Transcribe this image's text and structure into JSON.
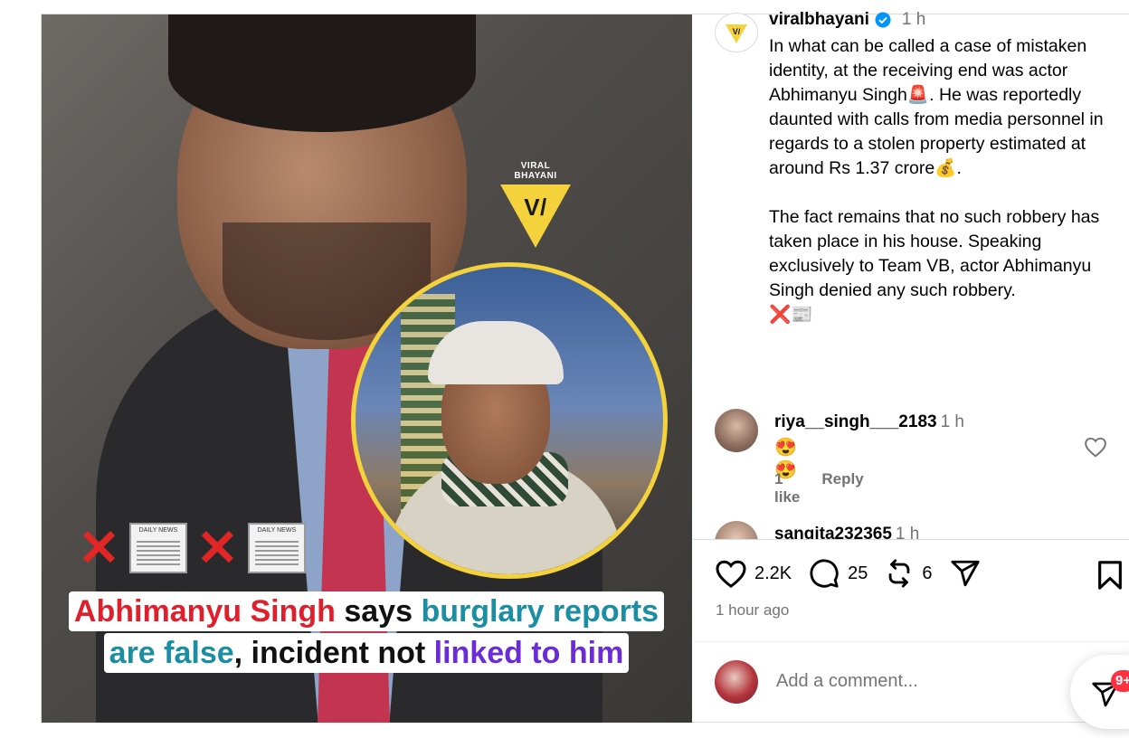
{
  "media": {
    "brand_text": "VIRAL BHAYANI",
    "newspaper_label": "DAILY NEWS",
    "headline": {
      "line1": [
        {
          "text": "Abhimanyu Singh",
          "color": "#e01f2c"
        },
        {
          "text": " says ",
          "color": "#111111"
        },
        {
          "text": "burglary reports",
          "color": "#1b8ea3"
        }
      ],
      "line2": [
        {
          "text": "are false",
          "color": "#1b8ea3"
        },
        {
          "text": ", incident not ",
          "color": "#111111"
        },
        {
          "text": "linked to him",
          "color": "#6b2bd9"
        }
      ]
    }
  },
  "post": {
    "username": "viralbhayani",
    "time": "1 h",
    "caption_p1": "In what can be called a case of mistaken identity, at the receiving end was actor Abhimanyu Singh🚨. He was reportedly daunted with calls from media personnel in regards to a stolen property estimated at around Rs 1.37 crore💰.",
    "caption_p2": "The fact remains that no such robbery has taken place in his house. Speaking exclusively to Team VB, actor Abhimanyu Singh denied any such robbery.",
    "caption_p3": "❌📰"
  },
  "comments": [
    {
      "username": "riya__singh___2183",
      "time": "1 h",
      "text": "😍😍",
      "likes": "1 like",
      "reply": "Reply"
    },
    {
      "username": "sangita232365",
      "time": "1 h"
    }
  ],
  "actions": {
    "likes": "2.2K",
    "comments": "25",
    "reposts": "6",
    "posted_ago": "1 hour ago"
  },
  "composer": {
    "placeholder": "Add a comment..."
  },
  "messages_badge": "9+",
  "colors": {
    "accent_yellow": "#f4d23c",
    "verified_blue": "#0095f6",
    "notification_red": "#ff3040",
    "muted_text": "#737373"
  }
}
